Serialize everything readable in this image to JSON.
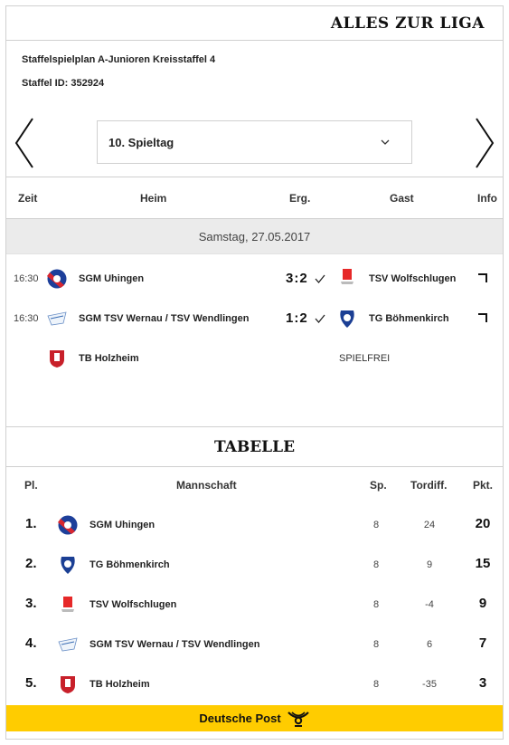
{
  "header": {
    "title": "ALLES ZUR LIGA"
  },
  "meta": {
    "plan": "Staffelspielplan A-Junioren Kreisstaffel 4",
    "staffel_id": "Staffel ID: 352924"
  },
  "nav": {
    "prev_icon": "chevron-left-icon",
    "next_icon": "chevron-right-icon",
    "selected": "10. Spieltag",
    "dropdown_icon": "chevron-down-icon"
  },
  "matches": {
    "columns": {
      "zeit": "Zeit",
      "heim": "Heim",
      "erg": "Erg.",
      "gast": "Gast",
      "info": "Info"
    },
    "date": "Samstag, 27.05.2017",
    "rows": [
      {
        "time": "16:30",
        "home": "SGM Uhingen",
        "score": "3:2",
        "guest": "TSV Wolfschlugen"
      },
      {
        "time": "16:30",
        "home": "SGM TSV Wernau / TSV Wendlingen",
        "score": "1:2",
        "guest": "TG Böhmenkirch"
      }
    ],
    "bye": {
      "team": "TB Holzheim",
      "label": "SPIELFREI"
    }
  },
  "table": {
    "title": "TABELLE",
    "columns": {
      "pl": "Pl.",
      "team": "Mannschaft",
      "sp": "Sp.",
      "td": "Tordiff.",
      "pkt": "Pkt."
    },
    "rows": [
      {
        "pl": "1.",
        "team": "SGM Uhingen",
        "sp": "8",
        "td": "24",
        "pkt": "20"
      },
      {
        "pl": "2.",
        "team": "TG Böhmenkirch",
        "sp": "8",
        "td": "9",
        "pkt": "15"
      },
      {
        "pl": "3.",
        "team": "TSV Wolfschlugen",
        "sp": "8",
        "td": "-4",
        "pkt": "9"
      },
      {
        "pl": "4.",
        "team": "SGM TSV Wernau / TSV Wendlingen",
        "sp": "8",
        "td": "6",
        "pkt": "7"
      },
      {
        "pl": "5.",
        "team": "TB Holzheim",
        "sp": "8",
        "td": "-35",
        "pkt": "3"
      }
    ]
  },
  "footer": {
    "sponsor": "Deutsche Post",
    "icon": "post-horn-icon"
  },
  "colors": {
    "accent_yellow": "#ffcc00",
    "uhingen_red": "#d8262f",
    "uhingen_blue": "#1d3f9a",
    "boehmenkirch_blue": "#1b3f94"
  }
}
